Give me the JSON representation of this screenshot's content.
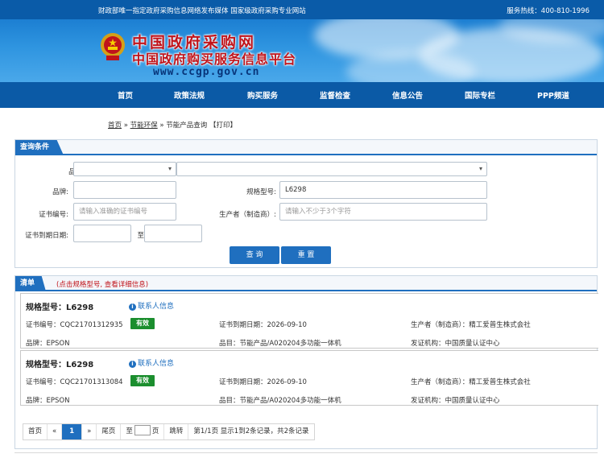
{
  "header": {
    "tagline": "财政部唯一指定政府采购信息网络发布媒体 国家级政府采购专业网站",
    "hotline": "服务热线：400-810-1996",
    "logo_title": "中国政府采购网",
    "logo_subtitle": "中国政府购买服务信息平台",
    "logo_url": "www.ccgp.gov.cn"
  },
  "nav": {
    "items": [
      "首页",
      "政策法规",
      "购买服务",
      "监督检查",
      "信息公告",
      "国际专栏",
      "PPP频道"
    ]
  },
  "breadcrumb": {
    "home": "首页",
    "sep1": " » ",
    "section": "节能环保",
    "sep2": " » ",
    "current": "节能产品查询",
    "print": "【打印】"
  },
  "query": {
    "title": "查询条件",
    "category_label": "品目:",
    "category_value": "",
    "subcategory_value": "",
    "brand_label": "品牌:",
    "brand_value": "",
    "model_label": "规格型号:",
    "model_value": "L6298",
    "cert_label": "证书编号:",
    "cert_placeholder": "请输入准确的证书编号",
    "maker_label": "生产者（制造商）:",
    "maker_placeholder": "请输入不少于3个字符",
    "expiry_label": "证书到期日期:",
    "expiry_from": "",
    "expiry_to_label": "至",
    "expiry_to": "",
    "search_button": "查 询",
    "reset_button": "重 置"
  },
  "results": {
    "title": "清单",
    "hint": "(点击规格型号, 查看详细信息)",
    "contact_label": "联系人信息",
    "records": [
      {
        "model": "规格型号：L6298",
        "cert_no": "证书编号：CQC21701312935",
        "status": "有效",
        "expiry": "证书到期日期：2026-09-10",
        "maker": "生产者（制造商）：精工爱普生株式会社",
        "brand": "品牌：EPSON",
        "category": "品目：节能产品/A020204多功能一体机",
        "issuer": "发证机构：中国质量认证中心"
      },
      {
        "model": "规格型号：L6298",
        "cert_no": "证书编号：CQC21701313084",
        "status": "有效",
        "expiry": "证书到期日期：2026-09-10",
        "maker": "生产者（制造商）：精工爱普生株式会社",
        "brand": "品牌：EPSON",
        "category": "品目：节能产品/A020204多功能一体机",
        "issuer": "发证机构：中国质量认证中心"
      }
    ]
  },
  "pager": {
    "first": "首页",
    "prev": "«",
    "current": "1",
    "next": "»",
    "last": "尾页",
    "goto_prefix": "至",
    "goto_suffix": "页",
    "jump": "跳转",
    "summary": "第1/1页  显示1到2条记录，共2条记录"
  },
  "colors": {
    "brand_blue": "#0b5aa6",
    "accent_blue": "#1f6fbf",
    "logo_red": "#c0141b",
    "valid_green": "#1b8e2e"
  }
}
